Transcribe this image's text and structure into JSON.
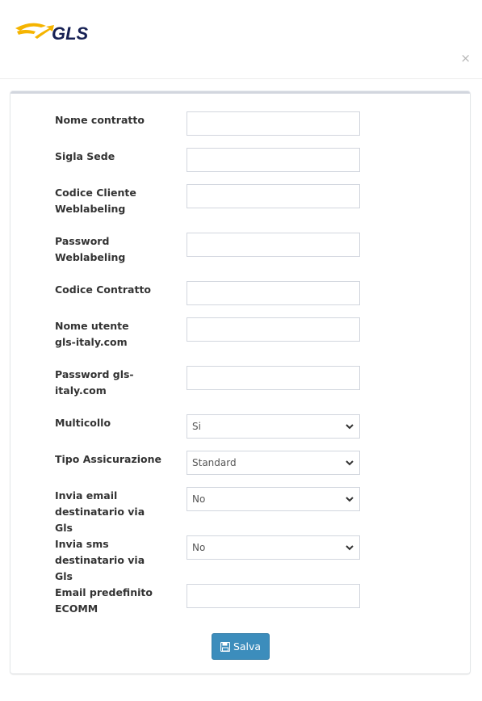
{
  "brand": {
    "logo_text": "GLS",
    "logo_color": "#172154",
    "swoosh_color": "#f5b400"
  },
  "dialog": {
    "close_symbol": "×"
  },
  "form": {
    "fields": [
      {
        "label": "Nome contratto",
        "type": "text",
        "value": ""
      },
      {
        "label": "Sigla Sede",
        "type": "text",
        "value": ""
      },
      {
        "label": "Codice Cliente Weblabeling",
        "type": "text",
        "value": ""
      },
      {
        "label": "Password Weblabeling",
        "type": "text",
        "value": ""
      },
      {
        "label": "Codice Contratto",
        "type": "text",
        "value": ""
      },
      {
        "label": "Nome utente gls-italy.com",
        "type": "text",
        "value": ""
      },
      {
        "label": "Password gls-italy.com",
        "type": "text",
        "value": ""
      },
      {
        "label": "Multicollo",
        "type": "select",
        "value": "Si"
      },
      {
        "label": "Tipo Assicurazione",
        "type": "select",
        "value": "Standard"
      },
      {
        "label": "Invia email destinatario via Gls",
        "type": "select",
        "value": "No"
      },
      {
        "label": "Invia sms destinatario via Gls",
        "type": "select",
        "value": "No"
      },
      {
        "label": "Email predefinito ECOMM",
        "type": "text",
        "value": ""
      }
    ],
    "save_label": "Salva",
    "save_icon": "save-icon"
  },
  "colors": {
    "primary_button": "#3c8dbc",
    "panel_border": "#d2d6de"
  }
}
